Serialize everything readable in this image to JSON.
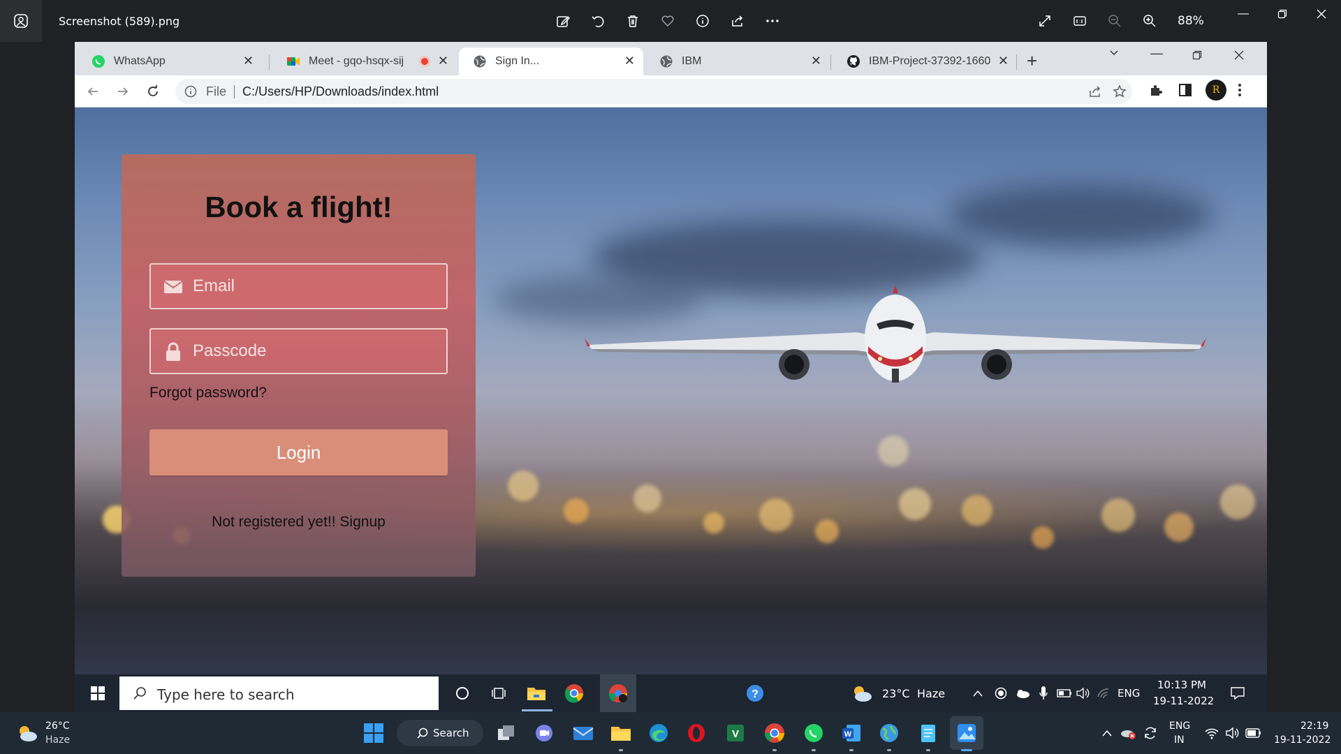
{
  "viewer": {
    "title": "Screenshot (589).png",
    "zoom": "88%",
    "tools": [
      "edit-image-icon",
      "rotate-icon",
      "delete-icon",
      "favorite-icon",
      "info-icon",
      "share-icon",
      "more-icon"
    ]
  },
  "browser": {
    "tabs": [
      {
        "label": "WhatsApp",
        "icon": "whatsapp-icon"
      },
      {
        "label": "Meet - gqo-hsqx-sij",
        "icon": "meet-icon",
        "recording": true
      },
      {
        "label": "Sign In...",
        "icon": "globe-icon",
        "active": true
      },
      {
        "label": "IBM",
        "icon": "globe-icon"
      },
      {
        "label": "IBM-Project-37392-1660",
        "icon": "github-icon"
      }
    ],
    "address": {
      "scheme": "File",
      "url": "C:/Users/HP/Downloads/index.html"
    },
    "profile_initial": "R"
  },
  "page": {
    "title": "Book a flight!",
    "email_placeholder": "Email",
    "passcode_placeholder": "Passcode",
    "forgot_label": "Forgot password?",
    "login_label": "Login",
    "signup_label": "Not registered yet!! Signup"
  },
  "inner_taskbar": {
    "search_placeholder": "Type here to search",
    "weather_temp": "23°C",
    "weather_desc": "Haze",
    "lang": "ENG",
    "time": "10:13 PM",
    "date": "19-11-2022"
  },
  "taskbar": {
    "weather_temp": "26°C",
    "weather_desc": "Haze",
    "search_label": "Search",
    "lang_line1": "ENG",
    "lang_line2": "IN",
    "time": "22:19",
    "date": "19-11-2022"
  },
  "colors": {
    "accent": "#d98e7a",
    "card_top": "#b86c5c",
    "card_mid": "#c46064",
    "taskbar": "#1f2a35"
  }
}
